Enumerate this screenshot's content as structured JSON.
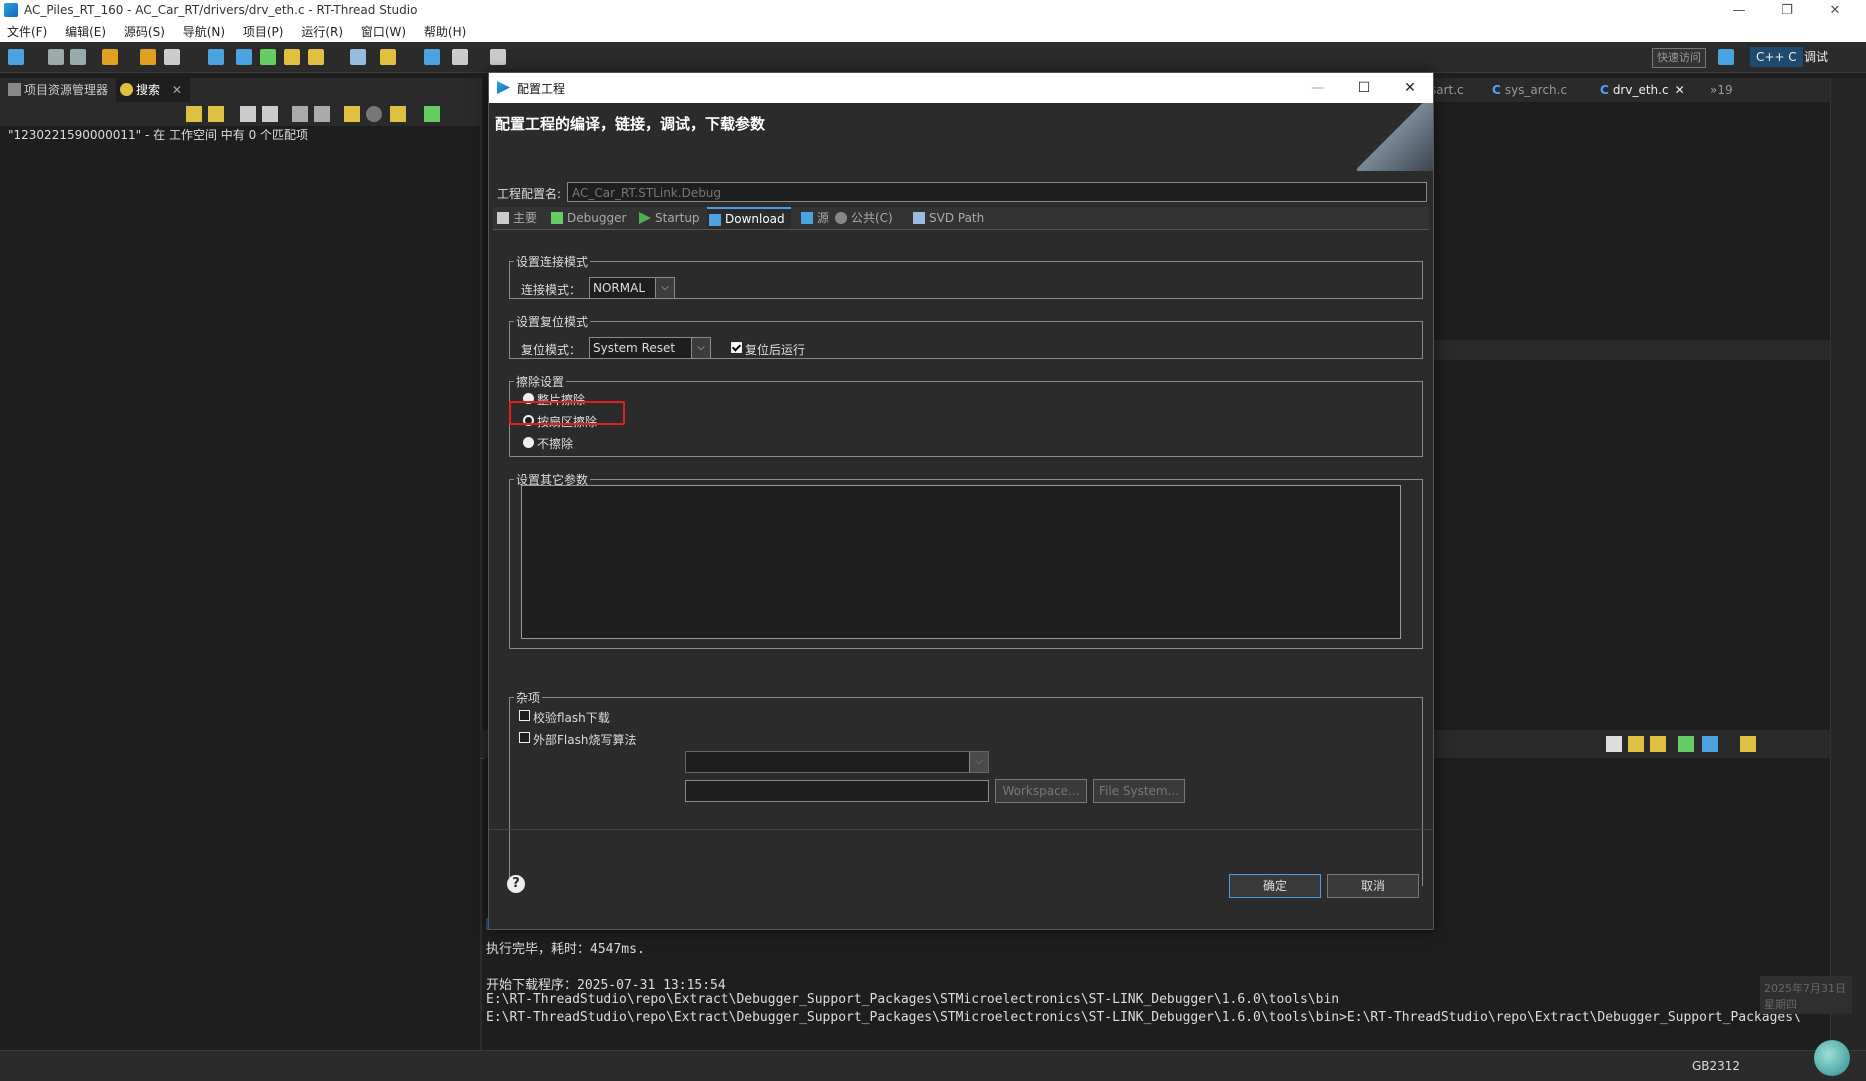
{
  "window": {
    "title": "AC_Piles_RT_160 - AC_Car_RT/drivers/drv_eth.c - RT-Thread Studio",
    "minimize": "—",
    "restore": "❐",
    "close": "✕"
  },
  "menu": [
    "文件(F)",
    "编辑(E)",
    "源码(S)",
    "导航(N)",
    "项目(P)",
    "运行(R)",
    "窗口(W)",
    "帮助(H)"
  ],
  "toolbar": {
    "quick_access": "快速访问",
    "perspective_cpp": "C++ C",
    "perspective_debug": "调试"
  },
  "left_panel": {
    "tabs": [
      "项目资源管理器",
      "搜索"
    ],
    "search_result": "\"1230221590000011\" - 在 工作空间 中有 0 个匹配项"
  },
  "editor": {
    "tabs": [
      "sart.c",
      "sys_arch.c",
      "drv_eth.c"
    ],
    "more_tabs": "»19"
  },
  "console": {
    "lines": [
      "执行完毕，耗时：4547ms.",
      "",
      "开始下载程序：2025-07-31 13:15:54",
      "E:\\RT-ThreadStudio\\repo\\Extract\\Debugger_Support_Packages\\STMicroelectronics\\ST-LINK_Debugger\\1.6.0\\tools\\bin",
      "E:\\RT-ThreadStudio\\repo\\Extract\\Debugger_Support_Packages\\STMicroelectronics\\ST-LINK_Debugger\\1.6.0\\tools\\bin>E:\\RT-ThreadStudio\\repo\\Extract\\Debugger_Support_Packages\\"
    ]
  },
  "status": {
    "encoding": "GB2312",
    "date": "2025年7月31日",
    "weekday": "星期四"
  },
  "dialog": {
    "title": "配置工程",
    "header": "配置工程的编译，链接，调试，下载参数",
    "config_name_label": "工程配置名:",
    "config_name_value": "AC_Car_RT.STLink.Debug",
    "tabs": [
      "主要",
      "Debugger",
      "Startup",
      "Download",
      "源",
      "公共(C)",
      "SVD Path"
    ],
    "active_tab": "Download",
    "connect_group": "设置连接模式",
    "connect_label": "连接模式：",
    "connect_value": "NORMAL",
    "reset_group": "设置复位模式",
    "reset_label": "复位模式：",
    "reset_value": "System Reset",
    "run_after_reset": "复位后运行",
    "erase_group": "擦除设置",
    "erase_options": [
      "整片擦除",
      "按扇区擦除",
      "不擦除"
    ],
    "other_group": "设置其它参数",
    "misc_group": "杂项",
    "verify_flash": "校验flash下载",
    "external_flash": "外部Flash烧写算法",
    "workspace_btn": "Workspace...",
    "filesystem_btn": "File System...",
    "ok": "确定",
    "cancel": "取消",
    "help": "?"
  }
}
